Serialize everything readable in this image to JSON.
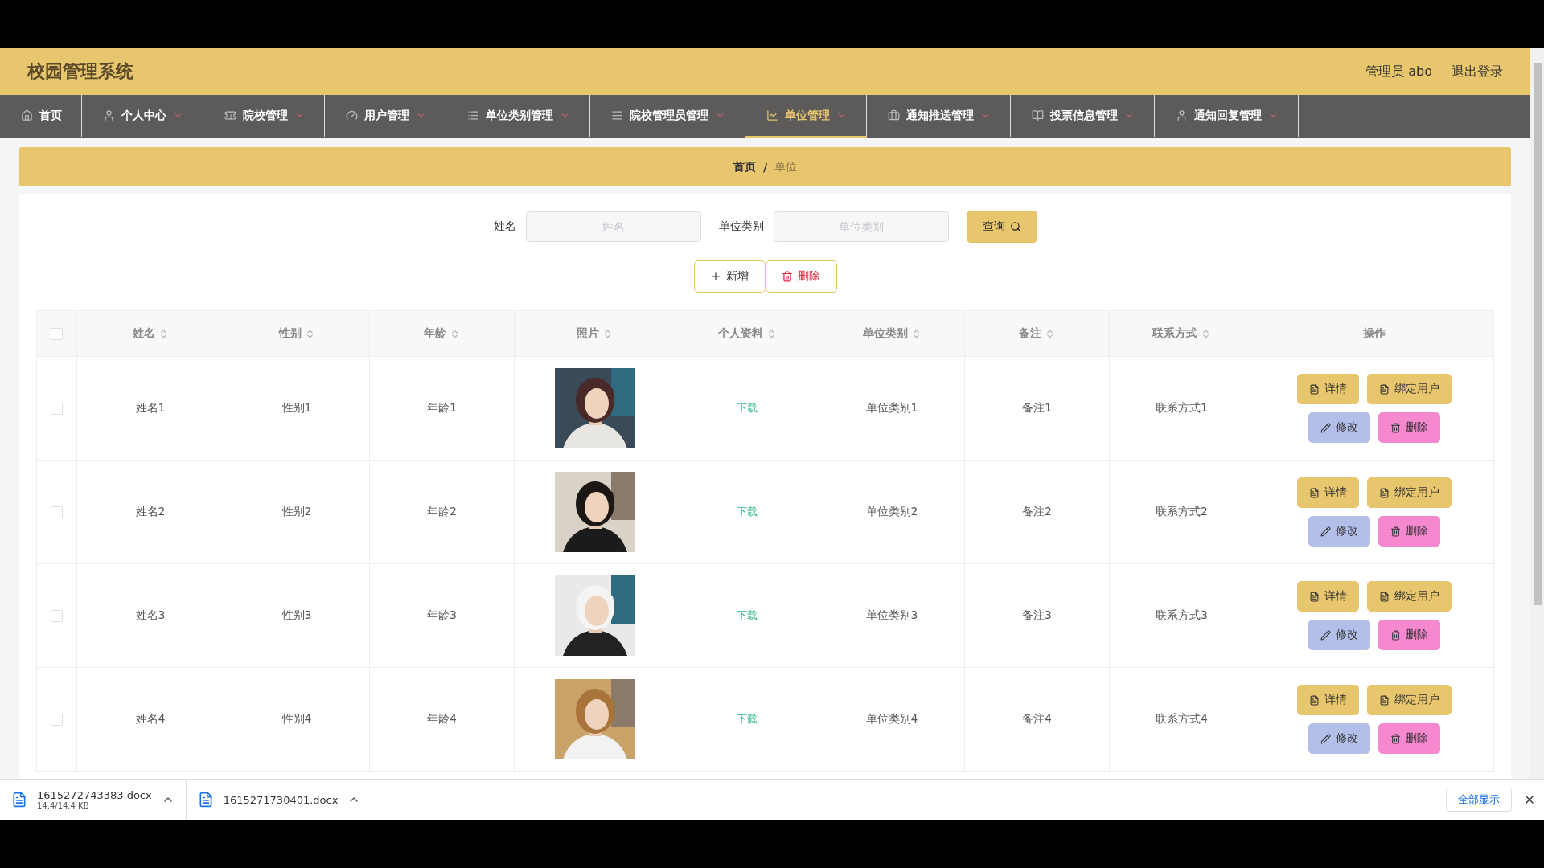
{
  "header": {
    "title": "校园管理系统",
    "user": "管理员 abo",
    "logout": "退出登录"
  },
  "nav": [
    {
      "label": "首页",
      "selected": false,
      "dropdown": false
    },
    {
      "label": "个人中心",
      "selected": false,
      "dropdown": true
    },
    {
      "label": "院校管理",
      "selected": false,
      "dropdown": true
    },
    {
      "label": "用户管理",
      "selected": false,
      "dropdown": true
    },
    {
      "label": "单位类别管理",
      "selected": false,
      "dropdown": true
    },
    {
      "label": "院校管理员管理",
      "selected": false,
      "dropdown": true
    },
    {
      "label": "单位管理",
      "selected": true,
      "dropdown": true
    },
    {
      "label": "通知推送管理",
      "selected": false,
      "dropdown": true
    },
    {
      "label": "投票信息管理",
      "selected": false,
      "dropdown": true
    },
    {
      "label": "通知回复管理",
      "selected": false,
      "dropdown": true
    }
  ],
  "breadcrumb": {
    "separator": "/",
    "items": [
      {
        "label": "首页",
        "current": false
      },
      {
        "label": "单位",
        "current": true
      }
    ]
  },
  "search": {
    "fields": [
      {
        "label": "姓名",
        "placeholder": "姓名"
      },
      {
        "label": "单位类别",
        "placeholder": "单位类别"
      }
    ],
    "button": "查询"
  },
  "actions": [
    {
      "label": "新增",
      "kind": "add"
    },
    {
      "label": "删除",
      "kind": "delete"
    }
  ],
  "table": {
    "select_all": {
      "checked": false
    },
    "columns": [
      {
        "label": "姓名",
        "sortable": true
      },
      {
        "label": "性别",
        "sortable": true
      },
      {
        "label": "年龄",
        "sortable": true
      },
      {
        "label": "照片",
        "sortable": true
      },
      {
        "label": "个人资料",
        "sortable": true
      },
      {
        "label": "单位类别",
        "sortable": true
      },
      {
        "label": "备注",
        "sortable": true
      },
      {
        "label": "联系方式",
        "sortable": true
      },
      {
        "label": "操作",
        "sortable": false
      }
    ],
    "rows": [
      {
        "checked": false,
        "name": "姓名1",
        "gender": "性别1",
        "age": "年龄1",
        "file": "下载",
        "type": "单位类别1",
        "note": "备注1",
        "contact": "联系方式1",
        "buttons": [
          {
            "label": "详情",
            "kind": "detail"
          },
          {
            "label": "绑定用户",
            "kind": "bind"
          },
          {
            "label": "修改",
            "kind": "edit"
          },
          {
            "label": "删除",
            "kind": "delete"
          }
        ]
      },
      {
        "checked": false,
        "name": "姓名2",
        "gender": "性别2",
        "age": "年龄2",
        "file": "下载",
        "type": "单位类别2",
        "note": "备注2",
        "contact": "联系方式2",
        "buttons": [
          {
            "label": "详情",
            "kind": "detail"
          },
          {
            "label": "绑定用户",
            "kind": "bind"
          },
          {
            "label": "修改",
            "kind": "edit"
          },
          {
            "label": "删除",
            "kind": "delete"
          }
        ]
      },
      {
        "checked": false,
        "name": "姓名3",
        "gender": "性别3",
        "age": "年龄3",
        "file": "下载",
        "type": "单位类别3",
        "note": "备注3",
        "contact": "联系方式3",
        "buttons": [
          {
            "label": "详情",
            "kind": "detail"
          },
          {
            "label": "绑定用户",
            "kind": "bind"
          },
          {
            "label": "修改",
            "kind": "edit"
          },
          {
            "label": "删除",
            "kind": "delete"
          }
        ]
      },
      {
        "checked": false,
        "name": "姓名4",
        "gender": "性别4",
        "age": "年龄4",
        "file": "下载",
        "type": "单位类别4",
        "note": "备注4",
        "contact": "联系方式4",
        "buttons": [
          {
            "label": "详情",
            "kind": "detail"
          },
          {
            "label": "绑定用户",
            "kind": "bind"
          },
          {
            "label": "修改",
            "kind": "edit"
          },
          {
            "label": "删除",
            "kind": "delete"
          }
        ]
      }
    ]
  },
  "downloads": {
    "items": [
      {
        "name": "1615272743383.docx",
        "size": "14.4/14.4 KB"
      },
      {
        "name": "1615271730401.docx"
      }
    ],
    "show_all": "全部显示"
  }
}
